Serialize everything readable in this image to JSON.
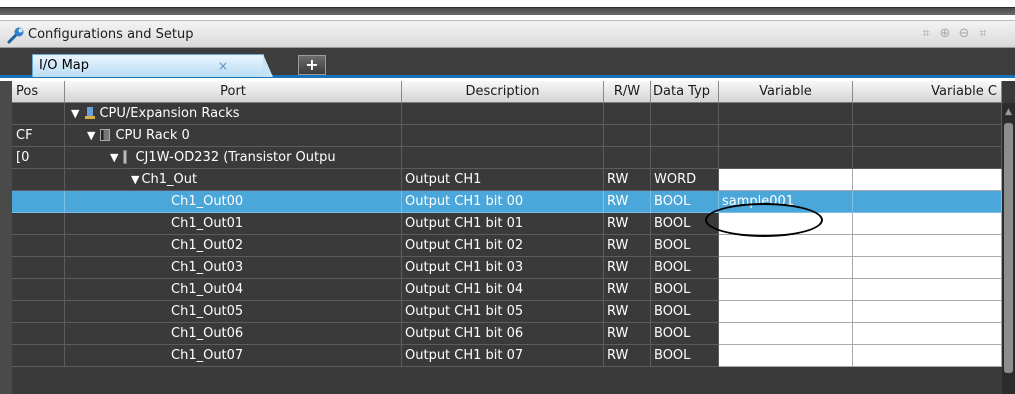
{
  "panel": {
    "title": "Configurations and Setup"
  },
  "tabs": [
    {
      "label": "I/O Map",
      "close": "×"
    }
  ],
  "add_tab": "+",
  "columns": {
    "position": "Pos",
    "port": "Port",
    "description": "Description",
    "rw": "R/W",
    "data_type": "Data Typ",
    "variable": "Variable",
    "variable_comment": "Variable C"
  },
  "rows": [
    {
      "pos": "",
      "port": "CPU/Expansion Racks",
      "description": "",
      "rw": "",
      "type": "",
      "variable": ""
    },
    {
      "pos": "CF",
      "port": "CPU Rack 0",
      "description": "",
      "rw": "",
      "type": "",
      "variable": ""
    },
    {
      "pos": "[0",
      "port": "CJ1W-OD232 (Transistor Outpu",
      "description": "",
      "rw": "",
      "type": "",
      "variable": ""
    },
    {
      "pos": "",
      "port": "Ch1_Out",
      "description": "Output CH1",
      "rw": "RW",
      "type": "WORD",
      "variable": ""
    },
    {
      "pos": "",
      "port": "Ch1_Out00",
      "description": "Output CH1 bit 00",
      "rw": "RW",
      "type": "BOOL",
      "variable": "sample001"
    },
    {
      "pos": "",
      "port": "Ch1_Out01",
      "description": "Output CH1 bit 01",
      "rw": "RW",
      "type": "BOOL",
      "variable": ""
    },
    {
      "pos": "",
      "port": "Ch1_Out02",
      "description": "Output CH1 bit 02",
      "rw": "RW",
      "type": "BOOL",
      "variable": ""
    },
    {
      "pos": "",
      "port": "Ch1_Out03",
      "description": "Output CH1 bit 03",
      "rw": "RW",
      "type": "BOOL",
      "variable": ""
    },
    {
      "pos": "",
      "port": "Ch1_Out04",
      "description": "Output CH1 bit 04",
      "rw": "RW",
      "type": "BOOL",
      "variable": ""
    },
    {
      "pos": "",
      "port": "Ch1_Out05",
      "description": "Output CH1 bit 05",
      "rw": "RW",
      "type": "BOOL",
      "variable": ""
    },
    {
      "pos": "",
      "port": "Ch1_Out06",
      "description": "Output CH1 bit 06",
      "rw": "RW",
      "type": "BOOL",
      "variable": ""
    },
    {
      "pos": "",
      "port": "Ch1_Out07",
      "description": "Output CH1 bit 07",
      "rw": "RW",
      "type": "BOOL",
      "variable": ""
    }
  ],
  "colors": {
    "selected_row": "#4ba6d9",
    "grid_bg": "#3a3a3a",
    "tab_underline": "#1a73b8"
  },
  "icons": {
    "panel": "wrench-icon",
    "toolbar": [
      "fit-icon",
      "zoom-in-icon",
      "zoom-out-icon",
      "fit-width-icon"
    ],
    "racks": "rack-icon",
    "cpu": "cpu-rack-icon",
    "unit": "unit-icon"
  }
}
